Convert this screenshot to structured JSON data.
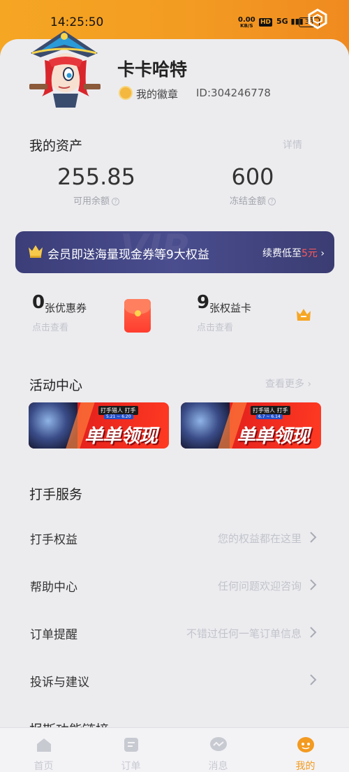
{
  "status_bar": {
    "time": "14:25:50",
    "net_speed_value": "0.00",
    "net_speed_unit": "KB/S",
    "hd": "HD",
    "signal": "5G",
    "battery": "33"
  },
  "profile": {
    "username": "卡卡哈特",
    "badge_label": "我的徽章",
    "user_id": "ID:304246778"
  },
  "assets": {
    "title": "我的资产",
    "details_link": "详情",
    "available_value": "255.85",
    "available_label": "可用余额",
    "frozen_value": "600",
    "frozen_label": "冻结金额"
  },
  "vip": {
    "watermark": "VIP",
    "text": "会员即送海量现金券等9大权益",
    "renew_prefix": "续费低至",
    "renew_price": "5元",
    "renew_arrow": "›"
  },
  "cards": {
    "coupon_count": "0",
    "coupon_unit": "张优惠券",
    "coupon_tap": "点击查看",
    "benefit_count": "9",
    "benefit_unit": "张权益卡",
    "benefit_tap": "点击查看"
  },
  "activity": {
    "title": "活动中心",
    "more_link": "查看更多",
    "more_arrow": "›",
    "banners": [
      {
        "brand": "打手猎人 打手",
        "dates": "5.21 ~ 6.20",
        "slogan": "单单领现金"
      },
      {
        "brand": "打手猎人 打手",
        "dates": "6.7 ~ 6.14",
        "slogan": "单单领现金"
      }
    ]
  },
  "services": {
    "title": "打手服务",
    "rows": [
      {
        "label": "打手权益",
        "hint": "您的权益都在这里"
      },
      {
        "label": "帮助中心",
        "hint": "任何问题欢迎咨询"
      },
      {
        "label": "订单提醒",
        "hint": "不错过任何一笔订单信息"
      },
      {
        "label": "投诉与建议",
        "hint": ""
      }
    ],
    "cut_off_title": "报斯功能链接"
  },
  "tabbar": {
    "tabs": [
      {
        "label": "首页",
        "icon": "home-icon"
      },
      {
        "label": "订单",
        "icon": "order-icon"
      },
      {
        "label": "消息",
        "icon": "message-icon"
      },
      {
        "label": "我的",
        "icon": "profile-icon"
      }
    ],
    "active_index": 3
  },
  "colors": {
    "accent": "#f39a20",
    "vip_bg": "#3b3e78",
    "price_red": "#ff5a5a",
    "page_bg": "#ececef"
  }
}
